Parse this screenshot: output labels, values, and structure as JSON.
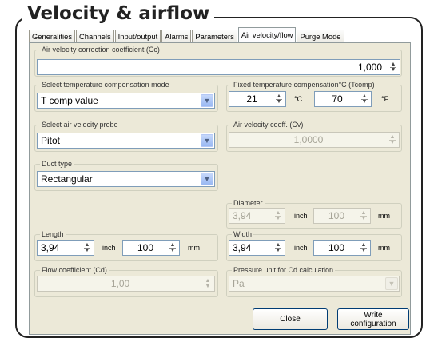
{
  "page": {
    "title": "Velocity & airflow"
  },
  "tabs": [
    {
      "label": "Generalities",
      "active": false
    },
    {
      "label": "Channels",
      "active": false
    },
    {
      "label": "Input/output",
      "active": false
    },
    {
      "label": "Alarms",
      "active": false
    },
    {
      "label": "Parameters",
      "active": false
    },
    {
      "label": "Air velocity/flow",
      "active": true
    },
    {
      "label": "Purge Mode",
      "active": false
    }
  ],
  "correction": {
    "label": "Air velocity correction coefficient (Cc)",
    "value": "1,000"
  },
  "temp_mode": {
    "label": "Select temperature compensation mode",
    "value": "T comp value"
  },
  "fixed_temp": {
    "label": "Fixed temperature compensation°C (Tcomp)",
    "celsius": "21",
    "celsius_unit": "°C",
    "fahrenheit": "70",
    "fahrenheit_unit": "°F"
  },
  "probe": {
    "label": "Select air velocity probe",
    "value": "Pitot"
  },
  "coeff_cv": {
    "label": "Air velocity coeff. (Cv)",
    "value": "1,0000"
  },
  "duct": {
    "label": "Duct type",
    "value": "Rectangular"
  },
  "diameter": {
    "label": "Diameter",
    "inch": "3,94",
    "inch_unit": "inch",
    "mm": "100",
    "mm_unit": "mm"
  },
  "length": {
    "label": "Length",
    "inch": "3,94",
    "inch_unit": "inch",
    "mm": "100",
    "mm_unit": "mm"
  },
  "width": {
    "label": "Width",
    "inch": "3,94",
    "inch_unit": "inch",
    "mm": "100",
    "mm_unit": "mm"
  },
  "flow_coeff": {
    "label": "Flow coefficient (Cd)",
    "value": "1,00"
  },
  "pressure_unit": {
    "label": "Pressure unit for Cd calculation",
    "value": "Pa"
  },
  "buttons": {
    "close": "Close",
    "write_line1": "Write",
    "write_line2": "configuration"
  },
  "icons": {
    "spin": "spin-arrows-icon",
    "dropdown": "chevron-down-icon"
  },
  "colors": {
    "panel": "#ece9d8",
    "field_border": "#7f9db9",
    "dropdown_button": "#99b8f2"
  }
}
